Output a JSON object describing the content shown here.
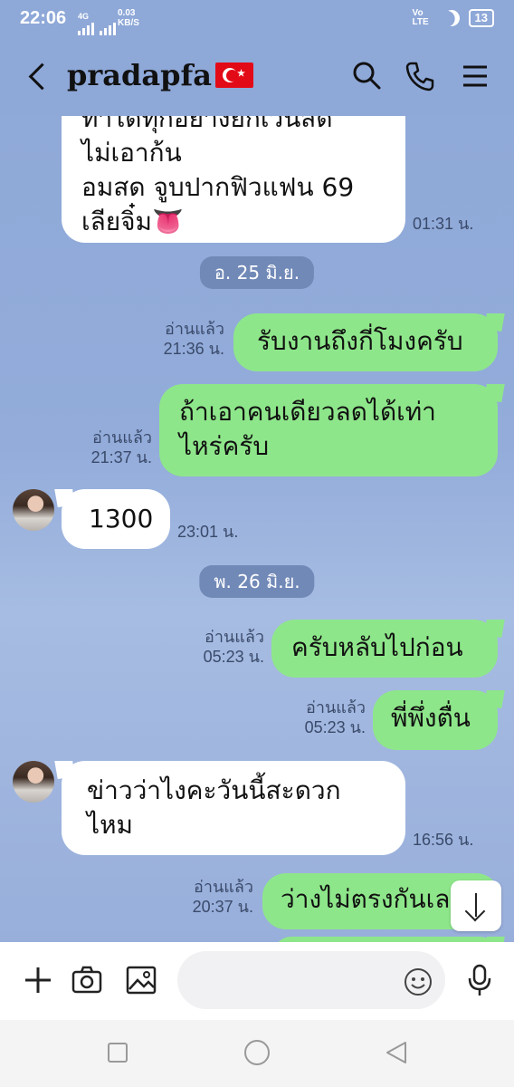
{
  "status_bar": {
    "time": "22:06",
    "network": "4G",
    "speed_value": "0.03",
    "speed_unit": "KB/S",
    "volte": "Vo LTE",
    "battery": "13"
  },
  "header": {
    "contact_name": "pradapfa",
    "flag_icon": "turkey-flag-icon"
  },
  "messages": [
    {
      "side": "in",
      "lines": [
        "ทำได้ทุกอย่างยกเว้นสด",
        "ไม่เอาก้น",
        "อมสด จูบปากฟิวแฟน 69",
        "เลียจิ๋ม👅"
      ],
      "time": "01:31 น."
    },
    {
      "type": "date",
      "text": "อ. 25 มิ.ย."
    },
    {
      "side": "out",
      "text": "รับงานถึงกี่โมงครับ",
      "read": "อ่านแล้ว",
      "time": "21:36 น."
    },
    {
      "side": "out",
      "lines": [
        "ถ้าเอาคนเดียวลดได้เท่า",
        "ไหร่ครับ"
      ],
      "read": "อ่านแล้ว",
      "time": "21:37 น."
    },
    {
      "side": "in",
      "text": "1300",
      "time": "23:01 น."
    },
    {
      "type": "date",
      "text": "พ. 26 มิ.ย."
    },
    {
      "side": "out",
      "text": "ครับหลับไปก่อน",
      "read": "อ่านแล้ว",
      "time": "05:23 น."
    },
    {
      "side": "out",
      "text": "พี่พึ่งตื่น",
      "read": "อ่านแล้ว",
      "time": "05:23 น."
    },
    {
      "side": "in",
      "lines": [
        "ข่าวว่าไงคะวันนี้สะดวก",
        "ไหม"
      ],
      "time": "16:56 น."
    },
    {
      "side": "out",
      "text": "ว่างไม่ตรงกันเล",
      "read": "อ่านแล้ว",
      "time": "20:37 น."
    }
  ],
  "input": {
    "placeholder": ""
  },
  "colors": {
    "chat_bg": "#8fa9d9",
    "outgoing_bubble": "#8ee68a",
    "incoming_bubble": "#ffffff",
    "date_chip": "#7189b7"
  }
}
